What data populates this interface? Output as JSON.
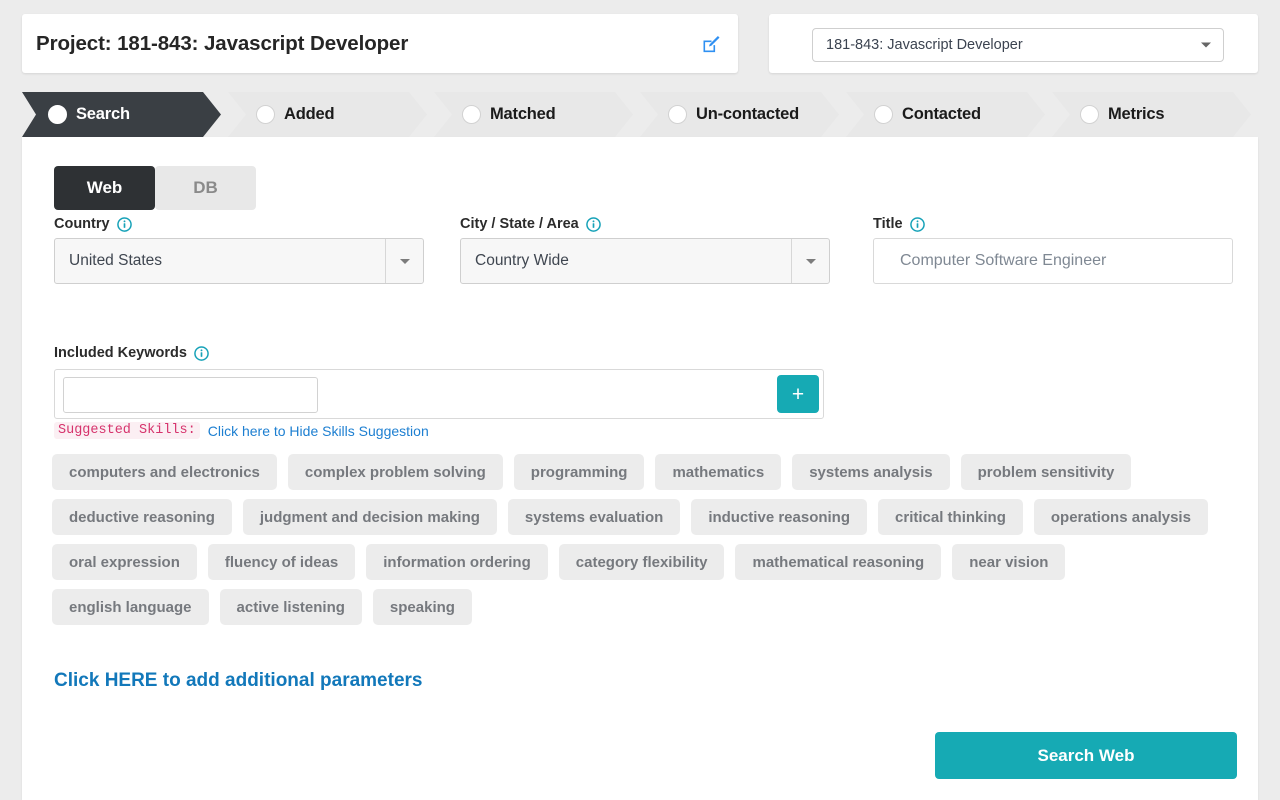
{
  "header": {
    "project_title": "Project: 181-843: Javascript Developer",
    "edit_icon": "edit-square-icon",
    "project_select_value": "181-843: Javascript Developer",
    "caret_icon": "chevron-down-icon"
  },
  "steps": [
    {
      "label": "Search",
      "active": true
    },
    {
      "label": "Added",
      "active": false
    },
    {
      "label": "Matched",
      "active": false
    },
    {
      "label": "Un-contacted",
      "active": false
    },
    {
      "label": "Contacted",
      "active": false
    },
    {
      "label": "Metrics",
      "active": false
    }
  ],
  "mode_tabs": [
    {
      "label": "Web",
      "active": true
    },
    {
      "label": "DB",
      "active": false
    }
  ],
  "fields": {
    "country": {
      "label": "Country",
      "info_icon": "info-circle-icon",
      "value": "United States"
    },
    "city_state_area": {
      "label": "City / State / Area",
      "info_icon": "info-circle-icon",
      "value": "Country Wide"
    },
    "title": {
      "label": "Title",
      "info_icon": "info-circle-icon",
      "value": "",
      "placeholder": "Computer Software Engineer"
    }
  },
  "keywords": {
    "label": "Included Keywords",
    "info_icon": "info-circle-icon",
    "input_value": "",
    "input_placeholder": "",
    "add_button_label": "+",
    "add_button_icon": "plus-icon"
  },
  "suggested": {
    "code_label": "Suggested Skills:",
    "link_text": "Click here to Hide Skills Suggestion"
  },
  "skill_tags": [
    "computers and electronics",
    "complex problem solving",
    "programming",
    "mathematics",
    "systems analysis",
    "problem sensitivity",
    "deductive reasoning",
    "judgment and decision making",
    "systems evaluation",
    "inductive reasoning",
    "critical thinking",
    "operations analysis",
    "oral expression",
    "fluency of ideas",
    "information ordering",
    "category flexibility",
    "mathematical reasoning",
    "near vision",
    "english language",
    "active listening",
    "speaking"
  ],
  "footer": {
    "add_params_link": "Click HERE to add additional parameters",
    "search_button": "Search Web"
  },
  "colors": {
    "teal": "#16aab4",
    "link_blue": "#1278ba",
    "step_active_bg": "#3a3f44",
    "step_inactive_bg": "#e8e8e8",
    "tag_bg": "#ececec",
    "code_red": "#d6336c"
  }
}
